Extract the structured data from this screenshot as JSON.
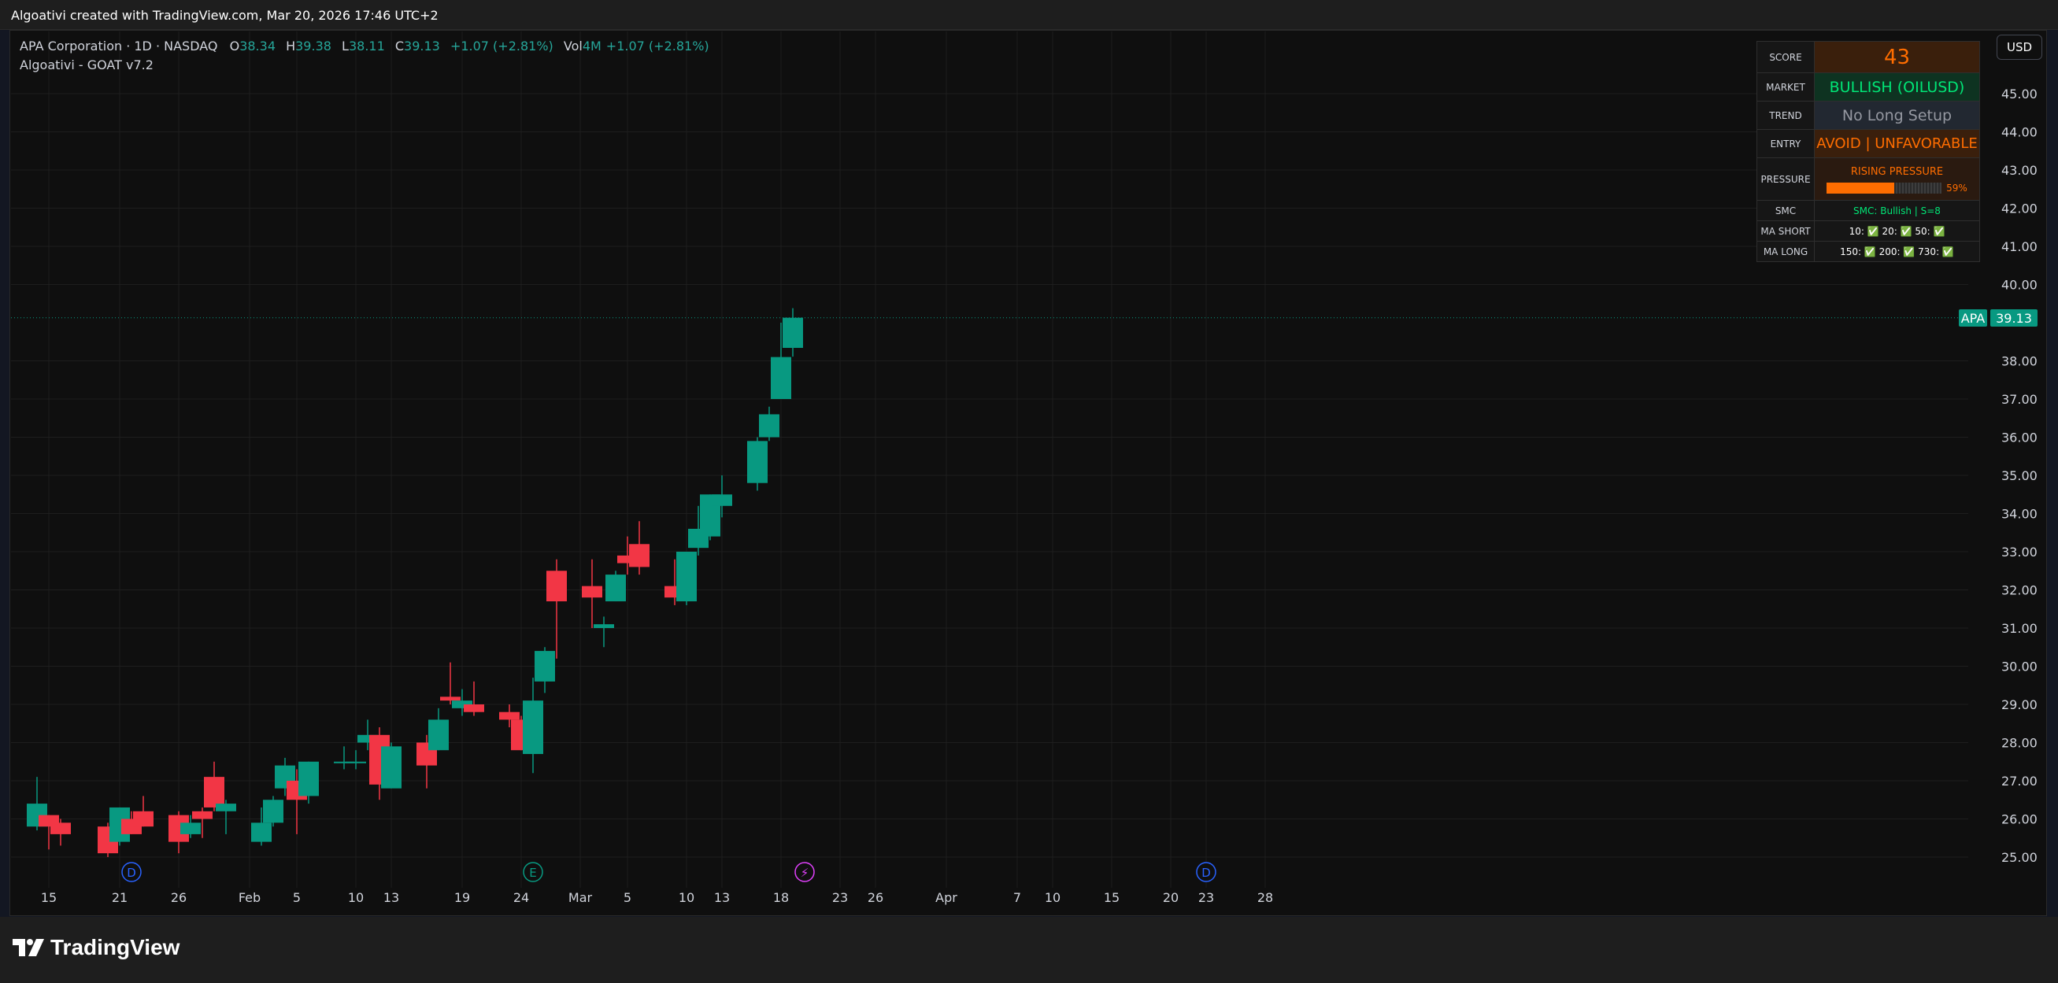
{
  "header": {
    "title": "Algoativi created with TradingView.com, Mar 20, 2026 17:46 UTC+2"
  },
  "legend": {
    "symbol": "APA Corporation · 1D · NASDAQ",
    "open_label": "O",
    "open": "38.34",
    "high_label": "H",
    "high": "39.38",
    "low_label": "L",
    "low": "38.11",
    "close_label": "C",
    "close": "39.13",
    "change": "+1.07 (+2.81%)",
    "vol_label": "Vol",
    "vol": "4M",
    "vol_change": "+1.07 (+2.81%)"
  },
  "indicator": {
    "name": "Algoativi - GOAT v7.2"
  },
  "currency_button": "USD",
  "price_label": {
    "ticker": "APA",
    "value": "39.13"
  },
  "panel": {
    "score_label": "SCORE",
    "score_value": "43",
    "market_label": "MARKET",
    "market_value": "BULLISH (OILUSD)",
    "trend_label": "TREND",
    "trend_value": "No Long Setup",
    "entry_label": "ENTRY",
    "entry_value": "AVOID | UNFAVORABLE",
    "pressure_label": "PRESSURE",
    "pressure_title": "RISING PRESSURE",
    "pressure_pct": "59%",
    "pressure_fraction": 0.59,
    "smc_label": "SMC",
    "smc_value": "SMC: Bullish | S=8",
    "ma_short_label": "MA SHORT",
    "ma_short_value": "10: ✅ 20: ✅ 50: ✅",
    "ma_long_label": "MA LONG",
    "ma_long_value": "150: ✅ 200: ✅ 730: ✅"
  },
  "colors": {
    "up": "#089981",
    "down": "#f23645",
    "score": "#ff6d00",
    "market": "#00e676",
    "entry": "#ff6d00",
    "trend": "#9598a1",
    "smc": "#00e676",
    "axis_text": "#d1d4dc"
  },
  "markers": [
    {
      "letter": "D",
      "date": "Jan 22",
      "color": "#2962ff"
    },
    {
      "letter": "E",
      "date": "Feb 25",
      "color": "#089981"
    },
    {
      "letter": "⚡",
      "date": "Mar 20",
      "color": "#e040fb"
    },
    {
      "letter": "D",
      "date": "Apr 23",
      "color": "#2962ff"
    }
  ],
  "branding": {
    "logo_text": "TradingView"
  },
  "chart_data": {
    "type": "candlestick",
    "yticks": [
      "45.00",
      "44.00",
      "43.00",
      "42.00",
      "41.00",
      "40.00",
      "38.00",
      "37.00",
      "36.00",
      "35.00",
      "34.00",
      "33.00",
      "32.00",
      "31.00",
      "30.00",
      "29.00",
      "28.00",
      "27.00",
      "26.00",
      "25.00"
    ],
    "ylim": [
      24.7,
      45.9
    ],
    "xticks": [
      "15",
      "21",
      "26",
      "Feb",
      "5",
      "10",
      "13",
      "19",
      "24",
      "Mar",
      "5",
      "10",
      "13",
      "18",
      "23",
      "26",
      "Apr",
      "7",
      "10",
      "15",
      "20",
      "23",
      "28"
    ],
    "xlim": [
      "2026-01-13",
      "2026-04-28"
    ],
    "candles": [
      {
        "date": "2026-01-14",
        "o": 25.8,
        "h": 27.1,
        "l": 25.7,
        "c": 26.4
      },
      {
        "date": "2026-01-15",
        "o": 26.1,
        "h": 26.1,
        "l": 25.2,
        "c": 25.8
      },
      {
        "date": "2026-01-16",
        "o": 25.9,
        "h": 26.0,
        "l": 25.3,
        "c": 25.6
      },
      {
        "date": "2026-01-20",
        "o": 25.8,
        "h": 25.9,
        "l": 25.0,
        "c": 25.1
      },
      {
        "date": "2026-01-21",
        "o": 25.4,
        "h": 26.3,
        "l": 25.3,
        "c": 26.3
      },
      {
        "date": "2026-01-22",
        "o": 26.0,
        "h": 26.2,
        "l": 25.6,
        "c": 25.6
      },
      {
        "date": "2026-01-23",
        "o": 26.2,
        "h": 26.6,
        "l": 25.8,
        "c": 25.8
      },
      {
        "date": "2026-01-26",
        "o": 26.1,
        "h": 26.2,
        "l": 25.1,
        "c": 25.4
      },
      {
        "date": "2026-01-27",
        "o": 25.6,
        "h": 26.1,
        "l": 25.5,
        "c": 25.9
      },
      {
        "date": "2026-01-28",
        "o": 26.2,
        "h": 26.3,
        "l": 25.5,
        "c": 26.0
      },
      {
        "date": "2026-01-29",
        "o": 27.1,
        "h": 27.5,
        "l": 26.2,
        "c": 26.3
      },
      {
        "date": "2026-01-30",
        "o": 26.2,
        "h": 26.5,
        "l": 25.6,
        "c": 26.4
      },
      {
        "date": "2026-02-02",
        "o": 25.4,
        "h": 26.3,
        "l": 25.3,
        "c": 25.9
      },
      {
        "date": "2026-02-03",
        "o": 25.9,
        "h": 26.6,
        "l": 25.8,
        "c": 26.5
      },
      {
        "date": "2026-02-04",
        "o": 26.8,
        "h": 27.6,
        "l": 26.6,
        "c": 27.4
      },
      {
        "date": "2026-02-05",
        "o": 27.0,
        "h": 27.3,
        "l": 25.6,
        "c": 26.5
      },
      {
        "date": "2026-02-06",
        "o": 26.6,
        "h": 27.5,
        "l": 26.4,
        "c": 27.5
      },
      {
        "date": "2026-02-09",
        "o": 27.5,
        "h": 27.9,
        "l": 27.3,
        "c": 27.5
      },
      {
        "date": "2026-02-10",
        "o": 27.5,
        "h": 27.8,
        "l": 27.3,
        "c": 27.5
      },
      {
        "date": "2026-02-11",
        "o": 28.0,
        "h": 28.6,
        "l": 27.8,
        "c": 28.2
      },
      {
        "date": "2026-02-12",
        "o": 28.2,
        "h": 28.4,
        "l": 26.5,
        "c": 26.9
      },
      {
        "date": "2026-02-13",
        "o": 26.8,
        "h": 28.0,
        "l": 26.8,
        "c": 27.9
      },
      {
        "date": "2026-02-16",
        "o": 28.0,
        "h": 28.2,
        "l": 26.8,
        "c": 27.4
      },
      {
        "date": "2026-02-17",
        "o": 27.8,
        "h": 28.9,
        "l": 27.8,
        "c": 28.6
      },
      {
        "date": "2026-02-18",
        "o": 29.2,
        "h": 30.1,
        "l": 29.0,
        "c": 29.1
      },
      {
        "date": "2026-02-19",
        "o": 28.9,
        "h": 29.4,
        "l": 28.7,
        "c": 29.1
      },
      {
        "date": "2026-02-20",
        "o": 29.0,
        "h": 29.6,
        "l": 28.7,
        "c": 28.8
      },
      {
        "date": "2026-02-23",
        "o": 28.8,
        "h": 29.0,
        "l": 28.4,
        "c": 28.6
      },
      {
        "date": "2026-02-24",
        "o": 28.6,
        "h": 28.7,
        "l": 27.8,
        "c": 27.8
      },
      {
        "date": "2026-02-25",
        "o": 27.7,
        "h": 29.7,
        "l": 27.2,
        "c": 29.1
      },
      {
        "date": "2026-02-26",
        "o": 29.6,
        "h": 30.5,
        "l": 29.3,
        "c": 30.4
      },
      {
        "date": "2026-02-27",
        "o": 32.5,
        "h": 32.8,
        "l": 30.2,
        "c": 31.7
      },
      {
        "date": "2026-03-02",
        "o": 32.1,
        "h": 32.8,
        "l": 31.0,
        "c": 31.8
      },
      {
        "date": "2026-03-03",
        "o": 31.0,
        "h": 31.3,
        "l": 30.5,
        "c": 31.1
      },
      {
        "date": "2026-03-04",
        "o": 31.7,
        "h": 32.5,
        "l": 31.7,
        "c": 32.4
      },
      {
        "date": "2026-03-05",
        "o": 32.9,
        "h": 33.4,
        "l": 32.4,
        "c": 32.7
      },
      {
        "date": "2026-03-06",
        "o": 33.2,
        "h": 33.8,
        "l": 32.4,
        "c": 32.6
      },
      {
        "date": "2026-03-09",
        "o": 32.1,
        "h": 32.8,
        "l": 31.6,
        "c": 31.8
      },
      {
        "date": "2026-03-10",
        "o": 31.7,
        "h": 33.0,
        "l": 31.6,
        "c": 33.0
      },
      {
        "date": "2026-03-11",
        "o": 33.1,
        "h": 34.2,
        "l": 32.9,
        "c": 33.6
      },
      {
        "date": "2026-03-12",
        "o": 33.4,
        "h": 34.5,
        "l": 33.3,
        "c": 34.5
      },
      {
        "date": "2026-03-13",
        "o": 34.2,
        "h": 35.0,
        "l": 33.9,
        "c": 34.5
      },
      {
        "date": "2026-03-16",
        "o": 34.8,
        "h": 36.0,
        "l": 34.6,
        "c": 35.9
      },
      {
        "date": "2026-03-17",
        "o": 36.0,
        "h": 36.8,
        "l": 35.9,
        "c": 36.6
      },
      {
        "date": "2026-03-18",
        "o": 37.0,
        "h": 39.0,
        "l": 37.0,
        "c": 38.1
      },
      {
        "date": "2026-03-19",
        "o": 38.34,
        "h": 39.38,
        "l": 38.11,
        "c": 39.13
      }
    ]
  }
}
